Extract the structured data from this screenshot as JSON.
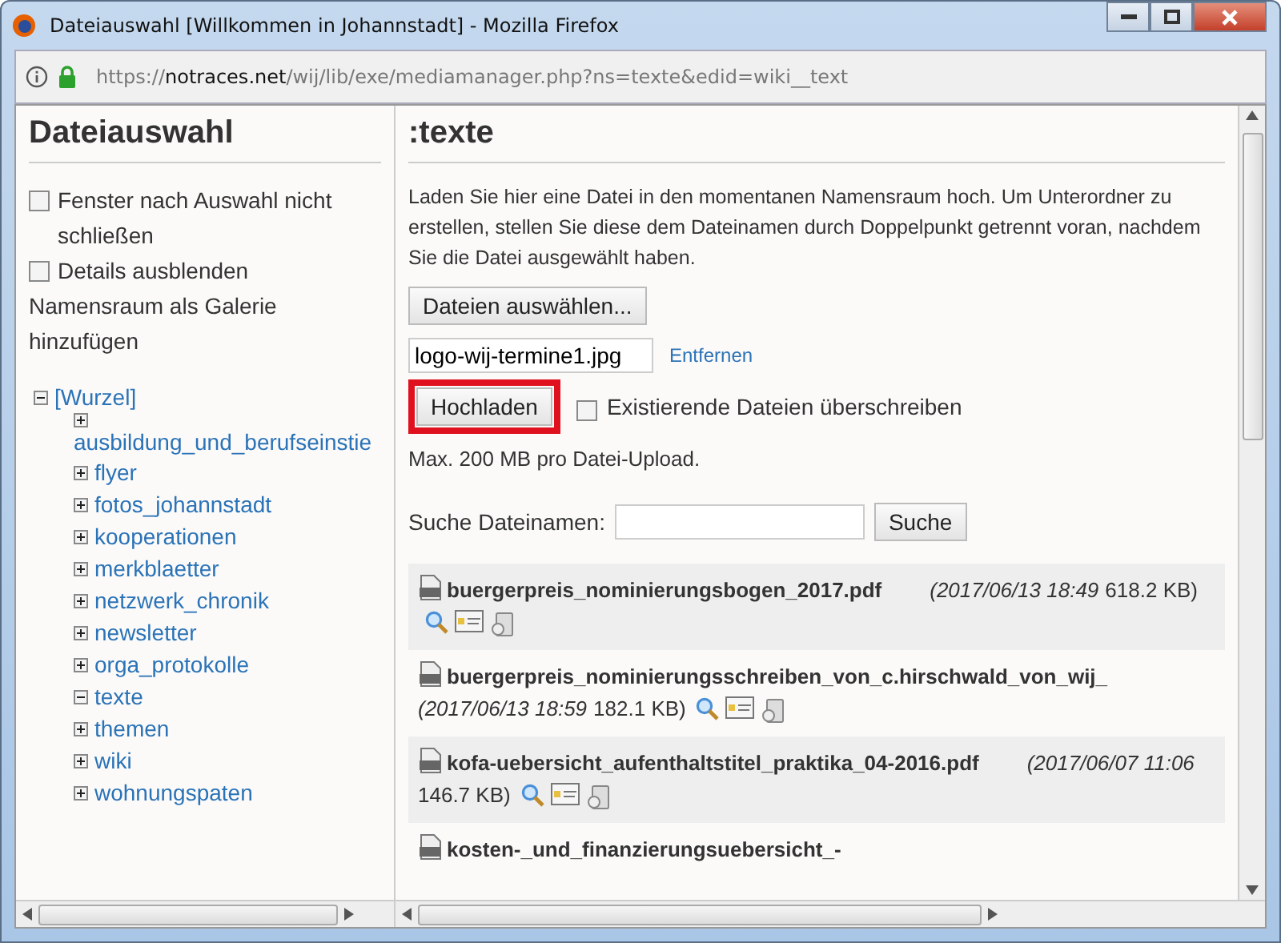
{
  "window": {
    "title": "Dateiauswahl [Willkommen in Johannstadt] - Mozilla Firefox"
  },
  "address_bar": {
    "scheme": "https://",
    "host": "notraces.net",
    "path": "/wij/lib/exe/mediamanager.php?ns=texte&edid=wiki__text"
  },
  "sidebar": {
    "title": "Dateiauswahl",
    "options": [
      {
        "label": "Fenster nach Auswahl nicht schließen",
        "checked": false
      },
      {
        "label": "Details ausblenden",
        "checked": false
      }
    ],
    "gallery_link": "Namensraum als Galerie hinzufügen",
    "tree": [
      {
        "label": "[Wurzel]",
        "expanded": true,
        "children": [
          {
            "label": "ausbildung_und_berufseinstie",
            "expanded": false
          },
          {
            "label": "flyer",
            "expanded": false
          },
          {
            "label": "fotos_johannstadt",
            "expanded": false
          },
          {
            "label": "kooperationen",
            "expanded": false
          },
          {
            "label": "merkblaetter",
            "expanded": false
          },
          {
            "label": "netzwerk_chronik",
            "expanded": false
          },
          {
            "label": "newsletter",
            "expanded": false
          },
          {
            "label": "orga_protokolle",
            "expanded": false
          },
          {
            "label": "texte",
            "expanded": true
          },
          {
            "label": "themen",
            "expanded": false
          },
          {
            "label": "wiki",
            "expanded": false
          },
          {
            "label": "wohnungspaten",
            "expanded": false
          }
        ]
      }
    ]
  },
  "main": {
    "title": ":texte",
    "intro": "Laden Sie hier eine Datei in den momentanen Namensraum hoch. Um Unterordner zu erstellen, stellen Sie diese dem Dateinamen durch Doppelpunkt getrennt voran, nachdem Sie die Datei ausgewählt haben.",
    "choose_button": "Dateien auswählen...",
    "file_value": "logo-wij-termine1.jpg",
    "remove_link": "Entfernen",
    "upload_button": {
      "label": "Hochladen",
      "highlighted": true
    },
    "overwrite": {
      "label": "Existierende Dateien überschreiben",
      "checked": false
    },
    "max_note": "Max. 200 MB pro Datei-Upload.",
    "search": {
      "label": "Suche Dateinamen:",
      "button": "Suche"
    },
    "files": [
      {
        "name": "buergerpreis_nominierungsbogen_2017.pdf",
        "date": "(2017/06/13 18:49",
        "size": "618.2 KB)"
      },
      {
        "name": "buergerpreis_nominierungsschreiben_von_c.hirschwald_von_wij_",
        "date": "(2017/06/13 18:59",
        "size": "182.1 KB)"
      },
      {
        "name": "kofa-uebersicht_aufenthaltstitel_praktika_04-2016.pdf",
        "date": "(2017/06/07 11:06",
        "size": "146.7 KB)"
      },
      {
        "name": "kosten-_und_finanzierungsuebersicht_-"
      }
    ]
  }
}
